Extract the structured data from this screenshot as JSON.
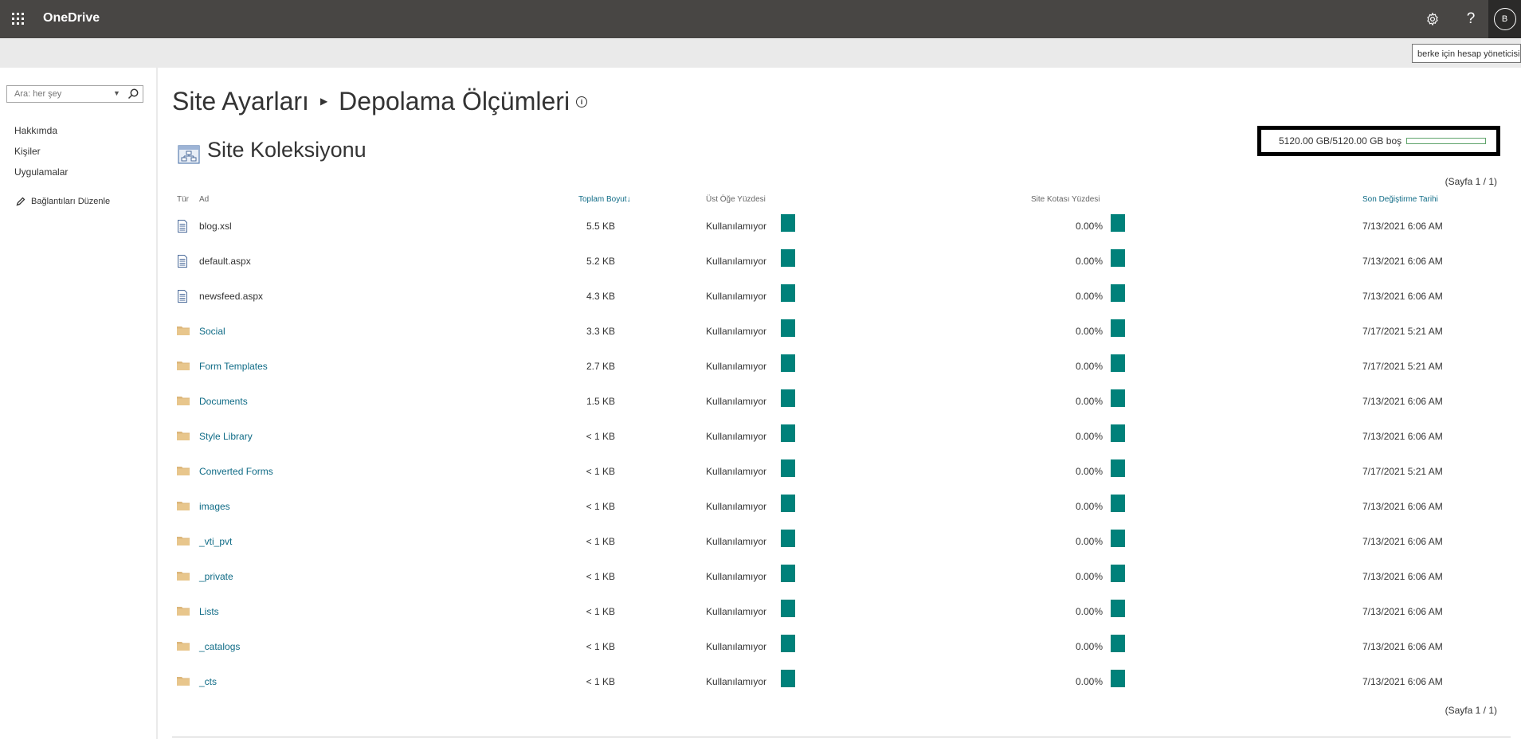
{
  "suitebar": {
    "brand": "OneDrive",
    "help_label": "?",
    "user_initial": "B",
    "tooltip": "berke için hesap yöneticisi",
    "icons": [
      "waffle-icon",
      "gear-icon",
      "help-icon"
    ]
  },
  "leftnav": {
    "search_placeholder": "Ara: her şey",
    "links": [
      "Hakkımda",
      "Kişiler",
      "Uygulamalar"
    ],
    "edit_links_label": "Bağlantıları Düzenle"
  },
  "page": {
    "breadcrumb_parent": "Site Ayarları",
    "breadcrumb_current": "Depolama Ölçümleri",
    "info_label": "i",
    "section_title": "Site Koleksiyonu",
    "quota_text": "5120.00 GB/5120.00 GB boş",
    "paging": "(Sayfa 1 / 1)"
  },
  "table": {
    "headers": {
      "type": "Tür",
      "name": "Ad",
      "size": "Toplam Boyut",
      "size_sort_indicator": "↓",
      "parent_pct": "Üst Öğe Yüzdesi",
      "quota_pct": "Site Kotası Yüzdesi",
      "modified": "Son Değiştirme Tarihi"
    },
    "bar_color": "#00817a",
    "folder_color": "#dcb67a",
    "link_color": "#0f6b86",
    "rows": [
      {
        "kind": "file",
        "name": "blog.xsl",
        "size": "5.5 KB",
        "parent_pct": "Kullanılamıyor",
        "quota_pct": "0.00%",
        "modified": "7/13/2021 6:06 AM"
      },
      {
        "kind": "file",
        "name": "default.aspx",
        "size": "5.2 KB",
        "parent_pct": "Kullanılamıyor",
        "quota_pct": "0.00%",
        "modified": "7/13/2021 6:06 AM"
      },
      {
        "kind": "file",
        "name": "newsfeed.aspx",
        "size": "4.3 KB",
        "parent_pct": "Kullanılamıyor",
        "quota_pct": "0.00%",
        "modified": "7/13/2021 6:06 AM"
      },
      {
        "kind": "folder",
        "name": "Social",
        "size": "3.3 KB",
        "parent_pct": "Kullanılamıyor",
        "quota_pct": "0.00%",
        "modified": "7/17/2021 5:21 AM"
      },
      {
        "kind": "folder",
        "name": "Form Templates",
        "size": "2.7 KB",
        "parent_pct": "Kullanılamıyor",
        "quota_pct": "0.00%",
        "modified": "7/17/2021 5:21 AM"
      },
      {
        "kind": "folder",
        "name": "Documents",
        "size": "1.5 KB",
        "parent_pct": "Kullanılamıyor",
        "quota_pct": "0.00%",
        "modified": "7/13/2021 6:06 AM"
      },
      {
        "kind": "folder",
        "name": "Style Library",
        "size": "< 1 KB",
        "parent_pct": "Kullanılamıyor",
        "quota_pct": "0.00%",
        "modified": "7/13/2021 6:06 AM"
      },
      {
        "kind": "folder",
        "name": "Converted Forms",
        "size": "< 1 KB",
        "parent_pct": "Kullanılamıyor",
        "quota_pct": "0.00%",
        "modified": "7/17/2021 5:21 AM"
      },
      {
        "kind": "folder",
        "name": "images",
        "size": "< 1 KB",
        "parent_pct": "Kullanılamıyor",
        "quota_pct": "0.00%",
        "modified": "7/13/2021 6:06 AM"
      },
      {
        "kind": "folder",
        "name": "_vti_pvt",
        "size": "< 1 KB",
        "parent_pct": "Kullanılamıyor",
        "quota_pct": "0.00%",
        "modified": "7/13/2021 6:06 AM"
      },
      {
        "kind": "folder",
        "name": "_private",
        "size": "< 1 KB",
        "parent_pct": "Kullanılamıyor",
        "quota_pct": "0.00%",
        "modified": "7/13/2021 6:06 AM"
      },
      {
        "kind": "folder",
        "name": "Lists",
        "size": "< 1 KB",
        "parent_pct": "Kullanılamıyor",
        "quota_pct": "0.00%",
        "modified": "7/13/2021 6:06 AM"
      },
      {
        "kind": "folder",
        "name": "_catalogs",
        "size": "< 1 KB",
        "parent_pct": "Kullanılamıyor",
        "quota_pct": "0.00%",
        "modified": "7/13/2021 6:06 AM"
      },
      {
        "kind": "folder",
        "name": "_cts",
        "size": "< 1 KB",
        "parent_pct": "Kullanılamıyor",
        "quota_pct": "0.00%",
        "modified": "7/13/2021 6:06 AM"
      }
    ]
  }
}
